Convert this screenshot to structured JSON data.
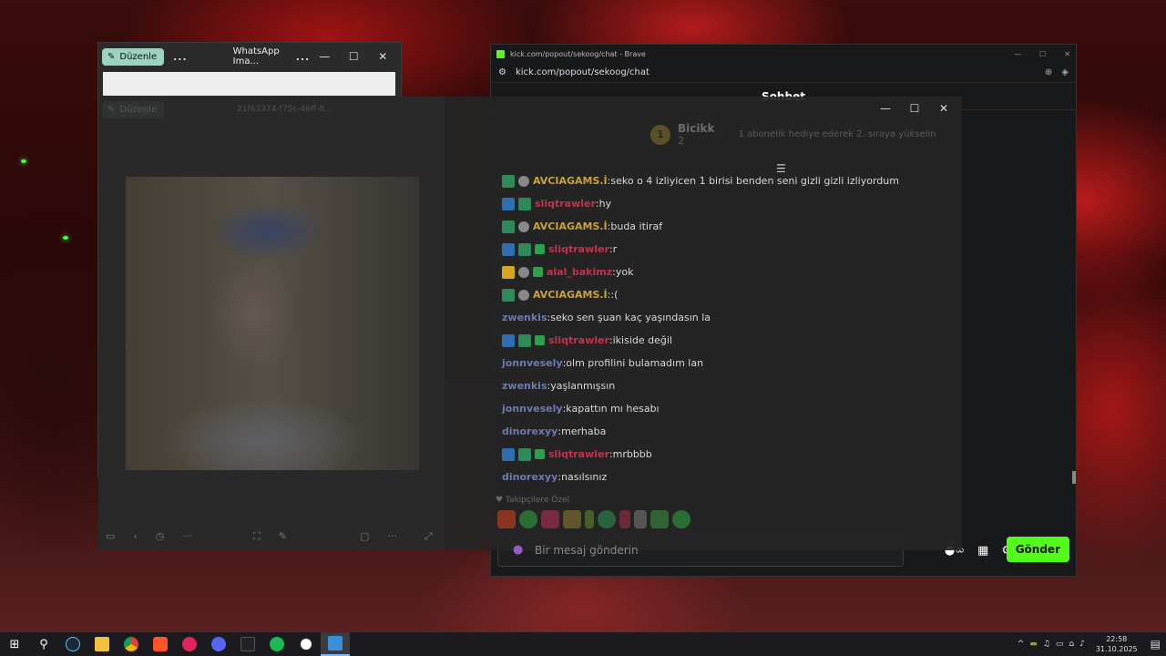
{
  "photos_window": {
    "edit_label": "Düzenle",
    "more": "...",
    "title": "WhatsApp Ima...",
    "minimize": "—",
    "maximize": "☐",
    "close": "✕"
  },
  "brave_window": {
    "title": "kick.com/popout/sekoog/chat - Brave",
    "address": "kick.com/popout/sekoog/chat",
    "chat_header": "Sohbet",
    "input_placeholder": "Bir mesaj gönderin",
    "send_label": "Gönder"
  },
  "overlay": {
    "ghost_title": "21f63374-f75c-46ff-8...",
    "ghost_edit": "Düzenle",
    "sub_banner": {
      "rank": "1",
      "name": "Bicikk",
      "count": "2",
      "message": "1 abonelik hediye ederek 2. sıraya yükselin"
    },
    "emote_label": "Takipçilere Özel"
  },
  "chat_messages": [
    {
      "badges": [
        "sub",
        "vip"
      ],
      "user": "AVCIAGAMS.İ",
      "color": "gold",
      "text": "seko o 4 izliyicen 1 birisi benden seni gizli gizli izliyordum"
    },
    {
      "badges": [
        "mod",
        "sub"
      ],
      "user": "sliqtrawler",
      "color": "red",
      "text": "hy"
    },
    {
      "badges": [
        "sub",
        "vip"
      ],
      "user": "AVCIAGAMS.İ",
      "color": "gold",
      "text": "buda itiraf"
    },
    {
      "badges": [
        "mod",
        "sub",
        "gift"
      ],
      "user": "sliqtrawler",
      "color": "red",
      "text": "r"
    },
    {
      "badges": [
        "crown",
        "vip",
        "gift"
      ],
      "user": "alal_bakimz",
      "color": "red",
      "text": "yok"
    },
    {
      "badges": [
        "sub",
        "vip"
      ],
      "user": "AVCIAGAMS.İ",
      "color": "gold",
      "text": ":("
    },
    {
      "badges": [],
      "user": "zwenkis",
      "color": "blue",
      "text": "seko sen şuan kaç yaşındasın la"
    },
    {
      "badges": [
        "mod",
        "sub",
        "gift"
      ],
      "user": "sliqtrawler",
      "color": "red",
      "text": "ikiside değil"
    },
    {
      "badges": [],
      "user": "jonnvesely",
      "color": "blue",
      "text": "olm profilini bulamadım lan"
    },
    {
      "badges": [],
      "user": "zwenkis",
      "color": "blue",
      "text": "yaşlanmışsın"
    },
    {
      "badges": [],
      "user": "jonnvesely",
      "color": "blue",
      "text": "kapattın mı hesabı"
    },
    {
      "badges": [],
      "user": "dinorexyy",
      "color": "blue",
      "text": "merhaba"
    },
    {
      "badges": [
        "mod",
        "sub",
        "gift"
      ],
      "user": "sliqtrawler",
      "color": "red",
      "text": "mrbbbb"
    },
    {
      "badges": [],
      "user": "dinorexyy",
      "color": "blue",
      "text": "nasılsınız"
    }
  ],
  "taskbar": {
    "apps": [
      "windows-start",
      "search",
      "steam",
      "file-explorer",
      "chrome",
      "brave",
      "media-player",
      "discord",
      "terminal",
      "spotify",
      "rockstar",
      "photos"
    ],
    "time": "22:58",
    "date": "31.10.2025"
  },
  "colors": {
    "kick_green": "#53fc18",
    "gold_user": "#c8a23c",
    "red_user": "#c0344c",
    "blue_user": "#6c7bb0"
  }
}
